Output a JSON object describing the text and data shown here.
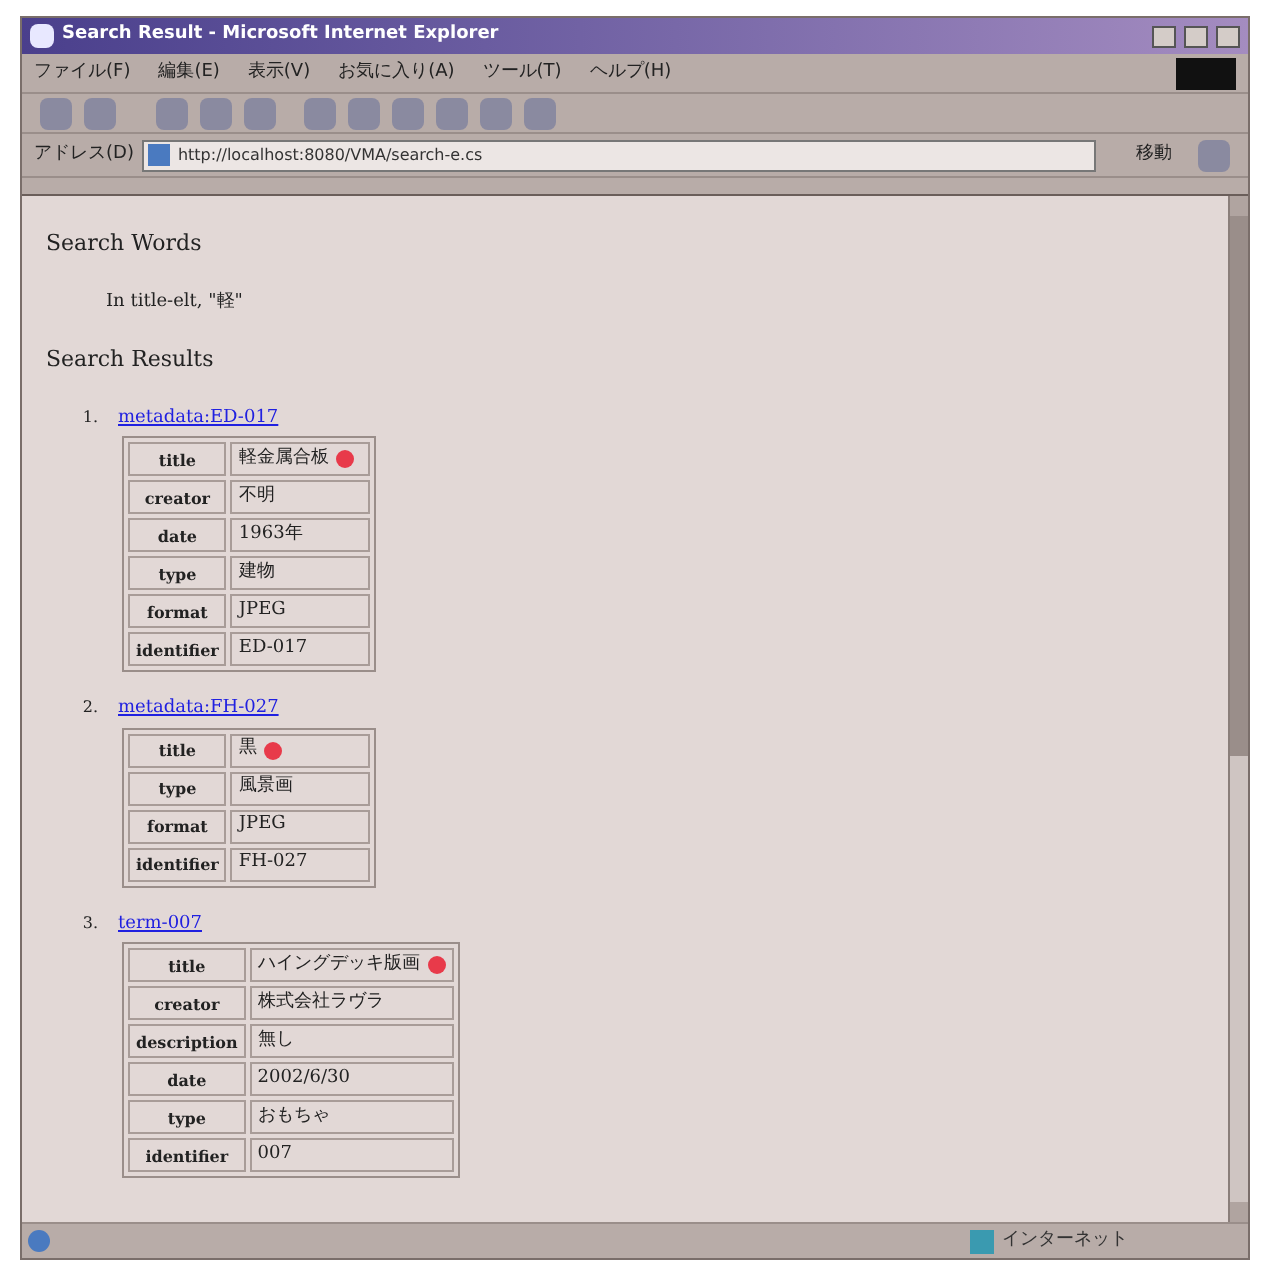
{
  "window": {
    "title": "Search Result - Microsoft Internet Explorer"
  },
  "menu": [
    "ファイル(F)",
    "編集(E)",
    "表示(V)",
    "お気に入り(A)",
    "ツール(T)",
    "ヘルプ(H)"
  ],
  "address": {
    "label": "アドレス(D)",
    "value": "http://localhost:8080/VMA/search-e.cs",
    "go": "移動"
  },
  "search_words": {
    "heading": "Search Words",
    "items": [
      "In title-elt, \"軽\""
    ]
  },
  "search_results": {
    "heading": "Search Results",
    "items": [
      {
        "number": "1.",
        "link": "metadata:ED-017",
        "fields": [
          {
            "name": "title",
            "value": "軽金属合板",
            "marked": true
          },
          {
            "name": "creator",
            "value": "不明",
            "marked": false
          },
          {
            "name": "date",
            "value": "1963年",
            "marked": false
          },
          {
            "name": "type",
            "value": "建物",
            "marked": false
          },
          {
            "name": "format",
            "value": "JPEG",
            "marked": false
          },
          {
            "name": "identifier",
            "value": "ED-017",
            "marked": false
          }
        ]
      },
      {
        "number": "2.",
        "link": "metadata:FH-027",
        "fields": [
          {
            "name": "title",
            "value": "黒",
            "marked": true
          },
          {
            "name": "type",
            "value": "風景画",
            "marked": false
          },
          {
            "name": "format",
            "value": "JPEG",
            "marked": false
          },
          {
            "name": "identifier",
            "value": "FH-027",
            "marked": false
          }
        ]
      },
      {
        "number": "3.",
        "link": "term-007",
        "fields": [
          {
            "name": "title",
            "value": "ハイングデッキ版画",
            "marked": true
          },
          {
            "name": "creator",
            "value": "株式会社ラヴラ",
            "marked": false
          },
          {
            "name": "description",
            "value": "無し",
            "marked": false
          },
          {
            "name": "date",
            "value": "2002/6/30",
            "marked": false
          },
          {
            "name": "type",
            "value": "おもちゃ",
            "marked": false
          },
          {
            "name": "identifier",
            "value": "007",
            "marked": false
          }
        ]
      }
    ]
  },
  "status_bar": {
    "zone": "インターネット"
  }
}
